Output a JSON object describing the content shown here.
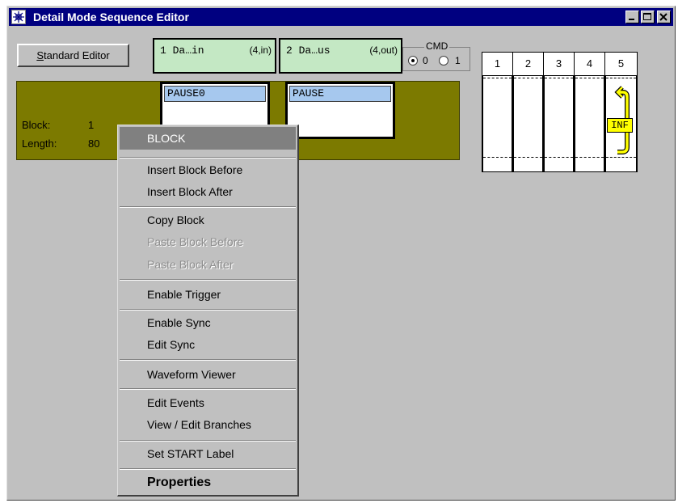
{
  "window": {
    "title": "Detail Mode Sequence Editor"
  },
  "toolbar": {
    "standard_editor_label_first": "S",
    "standard_editor_label_rest": "tandard Editor"
  },
  "channels": [
    {
      "name": "1 Da…in",
      "io": "(4,in)"
    },
    {
      "name": "2 Da…us",
      "io": "(4,out)"
    }
  ],
  "cmd": {
    "legend": "CMD",
    "options": [
      "0",
      "1"
    ],
    "selected": "0"
  },
  "grid": {
    "columns": [
      "1",
      "2",
      "3",
      "4",
      "5"
    ],
    "loop_label": "INF"
  },
  "sequence": {
    "block_label": "Block:",
    "block_value": "1",
    "length_label": "Length:",
    "length_value": "80",
    "cards": [
      "PAUSE0",
      "PAUSE"
    ]
  },
  "context_menu": {
    "header": "BLOCK",
    "items": [
      {
        "label": "Insert Block Before",
        "enabled": true
      },
      {
        "label": "Insert Block After",
        "enabled": true
      },
      {
        "label": "Copy Block",
        "enabled": true
      },
      {
        "label": "Paste Block Before",
        "enabled": false
      },
      {
        "label": "Paste Block After",
        "enabled": false
      },
      {
        "label": "Enable Trigger",
        "enabled": true
      },
      {
        "label": "Enable Sync",
        "enabled": true
      },
      {
        "label": "Edit Sync",
        "enabled": true
      },
      {
        "label": "Waveform Viewer",
        "enabled": true
      },
      {
        "label": "Edit Events",
        "enabled": true
      },
      {
        "label": "View / Edit Branches",
        "enabled": true
      },
      {
        "label": "Set START Label",
        "enabled": true
      },
      {
        "label": "Properties",
        "enabled": true,
        "bold": true
      }
    ]
  },
  "colors": {
    "titlebar": "#000080",
    "band": "#7c7a00",
    "channel_box": "#c4e8c4",
    "card_header": "#a6c8ee",
    "loop_arrow": "#ffff00"
  }
}
